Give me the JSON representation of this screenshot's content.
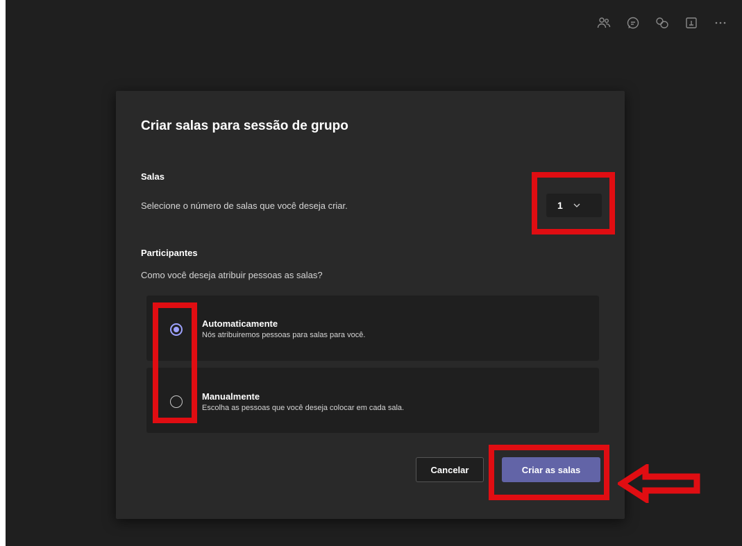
{
  "toolbar": {
    "icons": [
      "people-icon",
      "chat-icon",
      "breakout-rooms-icon",
      "notes-icon",
      "more-icon"
    ]
  },
  "dialog": {
    "title": "Criar salas para sessão de grupo",
    "rooms": {
      "label": "Salas",
      "description": "Selecione o número de salas que você deseja criar.",
      "selected_value": "1"
    },
    "participants": {
      "label": "Participantes",
      "question": "Como você deseja atribuir pessoas as salas?",
      "options": [
        {
          "title": "Automaticamente",
          "description": "Nós atribuiremos pessoas para salas para você.",
          "selected": true
        },
        {
          "title": "Manualmente",
          "description": "Escolha as pessoas que você deseja colocar em cada sala.",
          "selected": false
        }
      ]
    },
    "buttons": {
      "cancel": "Cancelar",
      "create": "Criar as salas"
    }
  },
  "colors": {
    "background": "#1f1f1f",
    "dialog": "#292929",
    "primary": "#6264a7",
    "radio_accent": "#9ea2ff",
    "annotation": "#e00d12"
  }
}
